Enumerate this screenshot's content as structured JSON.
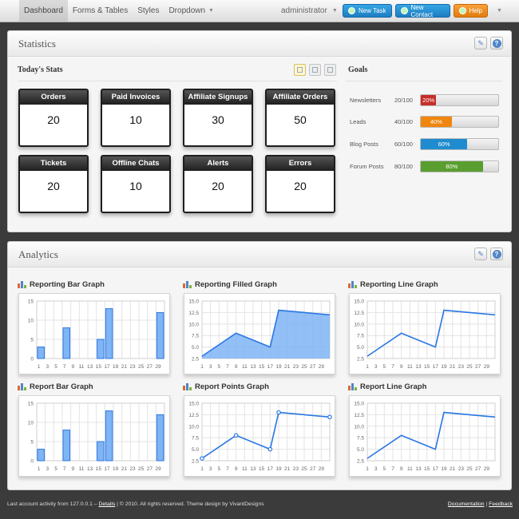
{
  "nav": {
    "items": [
      {
        "label": "Dashboard"
      },
      {
        "label": "Forms & Tables"
      },
      {
        "label": "Styles"
      },
      {
        "label": "Dropdown"
      }
    ],
    "user": "administrator",
    "buttons": {
      "new_task": "New Task",
      "new_contact": "New Contact",
      "help": "Help"
    }
  },
  "statistics": {
    "title": "Statistics",
    "todays_stats_title": "Today's Stats",
    "goals_title": "Goals",
    "stats": [
      {
        "label": "Orders",
        "value": "20"
      },
      {
        "label": "Paid Invoices",
        "value": "10"
      },
      {
        "label": "Affiliate Signups",
        "value": "30"
      },
      {
        "label": "Affiliate Orders",
        "value": "50"
      },
      {
        "label": "Tickets",
        "value": "20"
      },
      {
        "label": "Offline Chats",
        "value": "10"
      },
      {
        "label": "Alerts",
        "value": "20"
      },
      {
        "label": "Errors",
        "value": "20"
      }
    ],
    "goals": [
      {
        "label": "Newsletters",
        "count": "20/100",
        "percent": "20%",
        "fraction": 0.2,
        "color": "#c62e2a"
      },
      {
        "label": "Leads",
        "count": "40/100",
        "percent": "40%",
        "fraction": 0.4,
        "color": "#f0860f"
      },
      {
        "label": "Blog Posts",
        "count": "60/100",
        "percent": "60%",
        "fraction": 0.6,
        "color": "#1f8ccf"
      },
      {
        "label": "Forum Posts",
        "count": "80/100",
        "percent": "80%",
        "fraction": 0.8,
        "color": "#5a9e2f"
      }
    ]
  },
  "analytics": {
    "title": "Analytics",
    "graph_titles": [
      "Reporting Bar Graph",
      "Reporting Filled Graph",
      "Reporting Line Graph",
      "Report Bar Graph",
      "Report Points Graph",
      "Report Line Graph"
    ]
  },
  "chart_data": [
    {
      "type": "bar",
      "title": "Reporting Bar Graph",
      "x": [
        1,
        2,
        3,
        4,
        5,
        6,
        7,
        8,
        9,
        10,
        11,
        12,
        13,
        14,
        15,
        16,
        17,
        18,
        19,
        20,
        21,
        22,
        23,
        24,
        25,
        26,
        27,
        28,
        29,
        30
      ],
      "bars": [
        {
          "x": 2,
          "y": 3
        },
        {
          "x": 8,
          "y": 8
        },
        {
          "x": 16,
          "y": 5
        },
        {
          "x": 18,
          "y": 13
        },
        {
          "x": 30,
          "y": 12
        }
      ],
      "xticks": [
        1,
        3,
        5,
        7,
        9,
        11,
        13,
        15,
        17,
        19,
        21,
        23,
        25,
        27,
        29
      ],
      "yticks": [
        0,
        5,
        10,
        15
      ],
      "ylim": [
        0,
        15
      ]
    },
    {
      "type": "area",
      "title": "Reporting Filled Graph",
      "x": [
        1,
        9,
        17,
        19,
        31
      ],
      "y": [
        3,
        8,
        5,
        13,
        12
      ],
      "xticks": [
        1,
        3,
        5,
        7,
        9,
        11,
        13,
        15,
        17,
        19,
        21,
        23,
        25,
        27,
        29
      ],
      "yticks": [
        2.5,
        5.0,
        7.5,
        10.0,
        12.5,
        15.0
      ],
      "ylim": [
        2.5,
        15
      ]
    },
    {
      "type": "line",
      "title": "Reporting Line Graph",
      "x": [
        1,
        9,
        17,
        19,
        31
      ],
      "y": [
        3,
        8,
        5,
        13,
        12
      ],
      "xticks": [
        1,
        3,
        5,
        7,
        9,
        11,
        13,
        15,
        17,
        19,
        21,
        23,
        25,
        27,
        29
      ],
      "yticks": [
        2.5,
        5.0,
        7.5,
        10.0,
        12.5,
        15.0
      ],
      "ylim": [
        2.5,
        15
      ]
    },
    {
      "type": "bar",
      "title": "Report Bar Graph",
      "x": [
        1,
        2,
        3,
        4,
        5,
        6,
        7,
        8,
        9,
        10,
        11,
        12,
        13,
        14,
        15,
        16,
        17,
        18,
        19,
        20,
        21,
        22,
        23,
        24,
        25,
        26,
        27,
        28,
        29,
        30
      ],
      "bars": [
        {
          "x": 2,
          "y": 3
        },
        {
          "x": 8,
          "y": 8
        },
        {
          "x": 16,
          "y": 5
        },
        {
          "x": 18,
          "y": 13
        },
        {
          "x": 30,
          "y": 12
        }
      ],
      "xticks": [
        1,
        3,
        5,
        7,
        9,
        11,
        13,
        15,
        17,
        19,
        21,
        23,
        25,
        27,
        29
      ],
      "yticks": [
        0,
        5,
        10,
        15
      ],
      "ylim": [
        0,
        15
      ]
    },
    {
      "type": "scatter",
      "title": "Report Points Graph",
      "x": [
        1,
        9,
        17,
        19,
        31
      ],
      "y": [
        3,
        8,
        5,
        13,
        12
      ],
      "xticks": [
        1,
        3,
        5,
        7,
        9,
        11,
        13,
        15,
        17,
        19,
        21,
        23,
        25,
        27,
        29
      ],
      "yticks": [
        2.5,
        5.0,
        7.5,
        10.0,
        12.5,
        15.0
      ],
      "ylim": [
        2.5,
        15
      ]
    },
    {
      "type": "line",
      "title": "Report Line Graph",
      "x": [
        1,
        9,
        17,
        19,
        31
      ],
      "y": [
        3,
        8,
        5,
        13,
        12
      ],
      "xticks": [
        1,
        3,
        5,
        7,
        9,
        11,
        13,
        15,
        17,
        19,
        21,
        23,
        25,
        27,
        29
      ],
      "yticks": [
        2.5,
        5.0,
        7.5,
        10.0,
        12.5,
        15.0
      ],
      "ylim": [
        2.5,
        15
      ]
    }
  ],
  "footer": {
    "left_prefix": "Last account activity from 127.0.0.1 –",
    "details_link": "Details",
    "left_suffix": "| © 2010. All rights reserved. Theme design by VivantDesigns",
    "documentation_link": "Documentation",
    "separator": "|",
    "feedback_link": "Feedback"
  },
  "colors": {
    "accent_blue": "#1d7dc1",
    "accent_orange": "#e27b0d",
    "chart_blue": "#2a78e4",
    "chart_fill": "#7fb4f5"
  }
}
